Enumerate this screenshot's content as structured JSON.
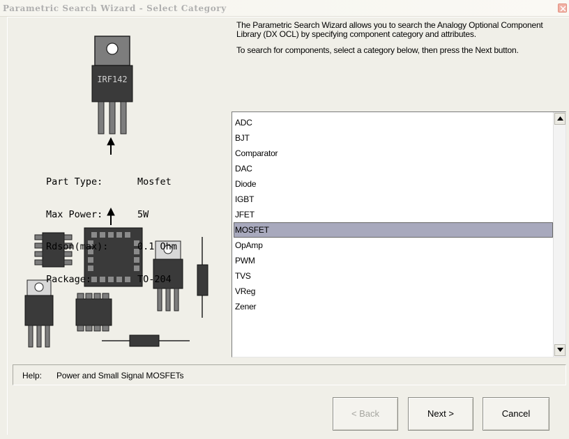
{
  "window": {
    "title": "Parametric Search Wizard - Select Category"
  },
  "description": {
    "paragraph1": "The Parametric Search Wizard allows you to search the Analogy Optional Component Library (DX OCL) by specifying component category and attributes.",
    "paragraph2": "To search for components, select a category below, then press the Next button."
  },
  "illustration": {
    "chip_label": "IRF142",
    "part_info": [
      {
        "key": "Part Type:",
        "value": "Mosfet"
      },
      {
        "key": "Max Power:",
        "value": "5W"
      },
      {
        "key": "Rdson(max):",
        "value": "0.1 Ohm"
      },
      {
        "key": "Package:",
        "value": "TO-204"
      }
    ]
  },
  "categories": {
    "items": [
      "ADC",
      "BJT",
      "Comparator",
      "DAC",
      "Diode",
      "IGBT",
      "JFET",
      "MOSFET",
      "OpAmp",
      "PWM",
      "TVS",
      "VReg",
      "Zener"
    ],
    "selected": "MOSFET"
  },
  "help": {
    "label": "Help:",
    "text": "Power and Small Signal MOSFETs"
  },
  "buttons": {
    "back": "< Back",
    "next": "Next >",
    "cancel": "Cancel"
  },
  "colors": {
    "selected_bg": "#a8a9bd",
    "dialog_bg": "#f0efe8",
    "component_fill": "#3a3a3a"
  }
}
